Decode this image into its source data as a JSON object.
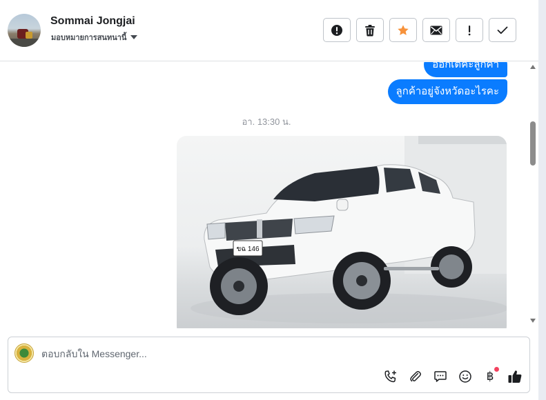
{
  "header": {
    "contact_name": "Sommai Jongjai",
    "assign_label": "มอบหมายการสนทนานี้",
    "actions": [
      {
        "name": "report-spam-button",
        "icon": "exclamation-circle-icon"
      },
      {
        "name": "delete-button",
        "icon": "trash-icon"
      },
      {
        "name": "star-button",
        "icon": "star-icon",
        "color": "#f7923b"
      },
      {
        "name": "email-button",
        "icon": "envelope-icon"
      },
      {
        "name": "mark-unread-button",
        "icon": "exclamation-icon"
      },
      {
        "name": "mark-done-button",
        "icon": "check-icon"
      }
    ]
  },
  "messages": {
    "bubble_1": "ออกเต็คะลูกค้า",
    "bubble_2": "ลูกค้าอยู่จังหวัดอะไรคะ",
    "timestamp": "อา. 13:30 น.",
    "photo_plate": "ขฉ 146"
  },
  "composer": {
    "placeholder": "ตอบกลับใน Messenger...",
    "tools": [
      "phone-plus-icon",
      "paperclip-icon",
      "chat-bubble-icon",
      "smile-icon",
      "baht-icon",
      "thumbs-up-icon"
    ],
    "baht_symbol": "฿"
  },
  "colors": {
    "accent": "#0a7cff",
    "star": "#f7923b",
    "notification_dot": "#f3425f"
  }
}
